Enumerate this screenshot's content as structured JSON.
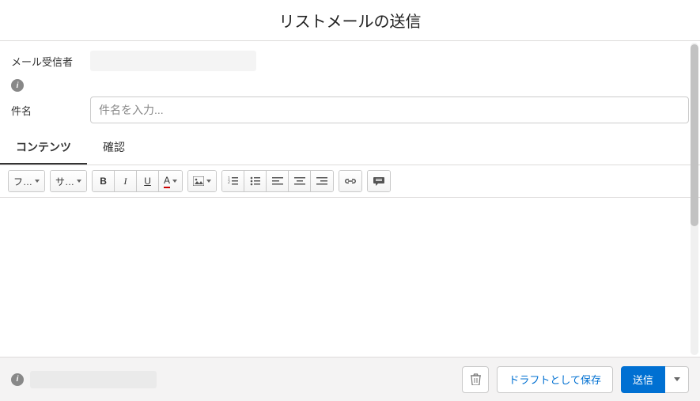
{
  "header": {
    "title": "リストメールの送信"
  },
  "recipients": {
    "label": "メール受信者",
    "value": ""
  },
  "subject": {
    "label": "件名",
    "placeholder": "件名を入力...",
    "value": ""
  },
  "tabs": {
    "content": "コンテンツ",
    "review": "確認"
  },
  "toolbar": {
    "font": "フ…",
    "size": "サ…",
    "bold": "B",
    "italic": "I",
    "underline": "U",
    "textcolor": "A"
  },
  "footer": {
    "save_draft": "ドラフトとして保存",
    "send": "送信"
  }
}
